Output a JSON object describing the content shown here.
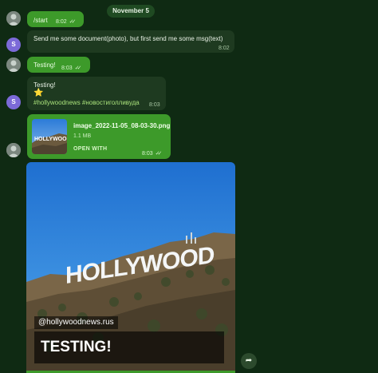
{
  "date_separator": "November 5",
  "messages": [
    {
      "direction": "out",
      "text": "/start",
      "time": "8:02",
      "status": "read"
    },
    {
      "direction": "in",
      "sender_initial": "S",
      "text": "Send me some document(photo), but first send me some msg(text)",
      "time": "8:02"
    },
    {
      "direction": "out",
      "text": "Testing!",
      "time": "8:03",
      "status": "read"
    },
    {
      "direction": "in",
      "sender_initial": "S",
      "line1": "Testing!",
      "emoji": "⭐",
      "hashtags": "#hollywoodnews #новостиголливуда",
      "time": "8:03"
    },
    {
      "direction": "out",
      "type": "file",
      "file_name": "image_2022-11-05_08-03-30.png",
      "file_size": "1.1 MB",
      "action": "OPEN WITH",
      "time": "8:03",
      "status": "read"
    },
    {
      "direction": "out",
      "type": "photo",
      "sign_text": "HOLLYWOOD",
      "handle": "@hollywoodnews.rus",
      "caption": "TESTING!"
    }
  ],
  "icons": {
    "read_receipt": "double-check-icon",
    "forward": "forward-arrow-icon",
    "own_avatar": "user-photo-icon"
  },
  "colors": {
    "background": "#0f2a13",
    "outgoing_bubble": "#3d9a2a",
    "incoming_bubble": "#1e3a20",
    "sender_avatar": "#7c6ad8",
    "hashtag": "#a8e07a"
  }
}
